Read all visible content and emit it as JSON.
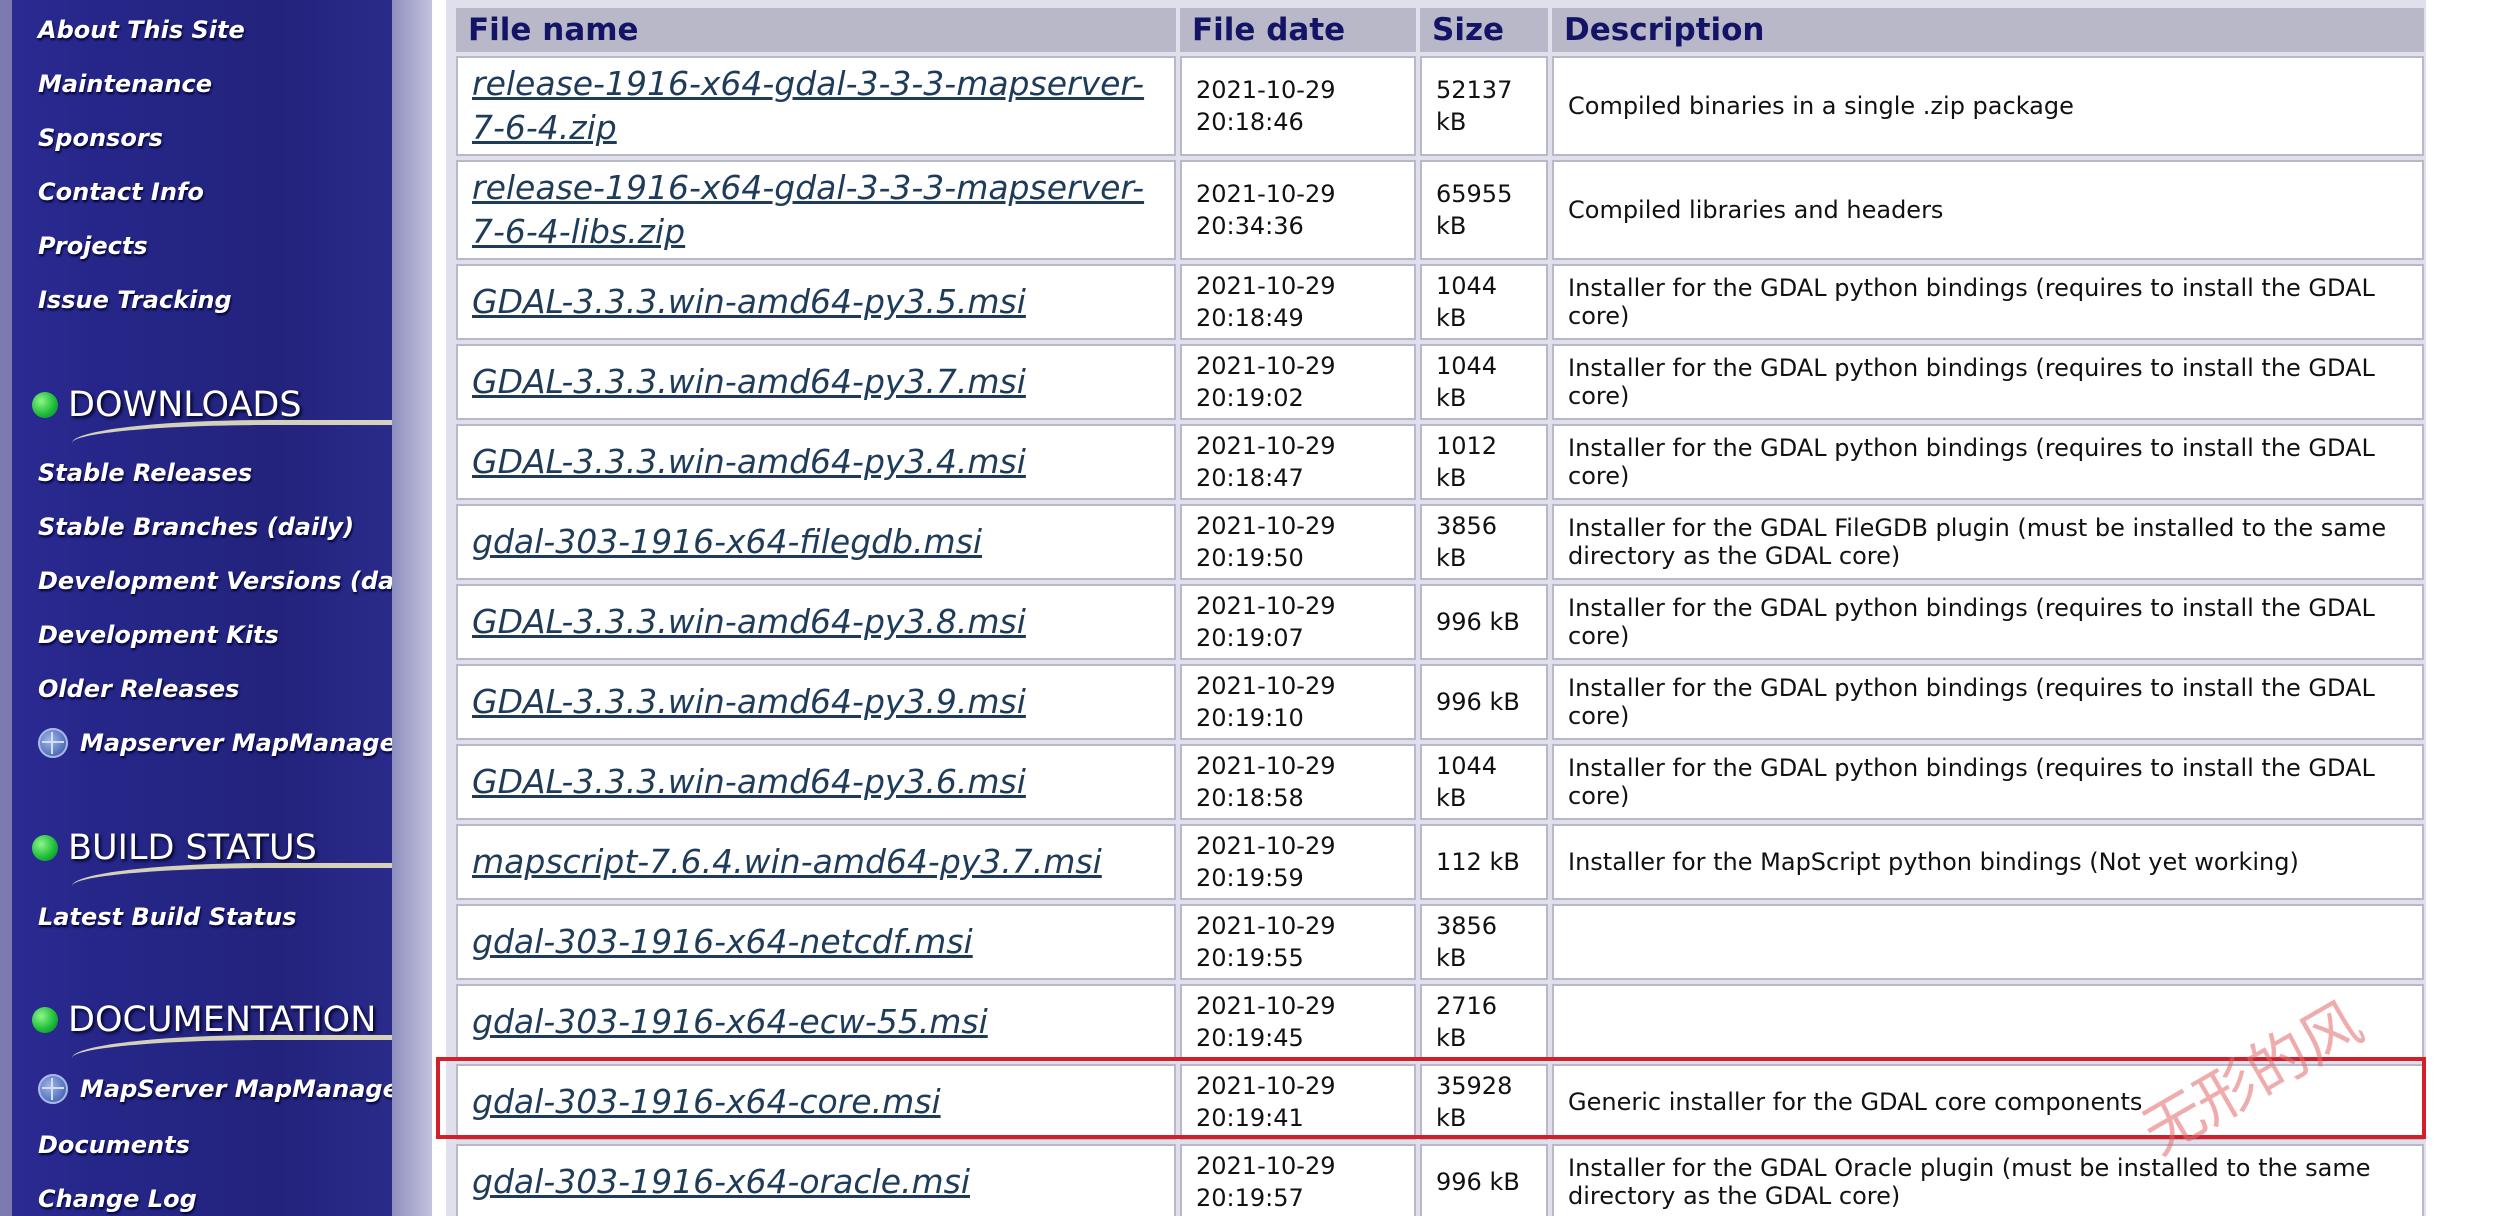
{
  "sidebar": {
    "links_top": [
      "About This Site",
      "Maintenance",
      "Sponsors",
      "Contact Info",
      "Projects",
      "Issue Tracking"
    ],
    "downloads": {
      "title": "DOWNLOADS",
      "items": [
        "Stable Releases",
        "Stable Branches (daily)",
        "Development Versions (daily)",
        "Development Kits",
        "Older Releases",
        "Mapserver MapManager"
      ]
    },
    "build_status": {
      "title": "BUILD STATUS",
      "items": [
        "Latest Build Status"
      ]
    },
    "documentation": {
      "title": "DOCUMENTATION",
      "items": [
        "MapServer MapManager",
        "Documents",
        "Change Log"
      ]
    },
    "icons": {
      "section": "green-globe-icon",
      "mapmanager": "globe-icon"
    }
  },
  "table": {
    "headers": {
      "file_name": "File name",
      "file_date": "File date",
      "size": "Size",
      "description": "Description"
    },
    "rows": [
      {
        "name_line1": "release-1916-x64-gdal-3-3-3-mapserver-",
        "name_line2": "7-6-4.zip",
        "date": "2021-10-29",
        "time": "20:18:46",
        "size": "52137",
        "size_unit": "kB",
        "description": "Compiled binaries in a single .zip package",
        "description2": ""
      },
      {
        "name_line1": "release-1916-x64-gdal-3-3-3-mapserver-",
        "name_line2": "7-6-4-libs.zip",
        "date": "2021-10-29",
        "time": "20:34:36",
        "size": "65955",
        "size_unit": "kB",
        "description": "Compiled libraries and headers",
        "description2": ""
      },
      {
        "name_line1": "GDAL-3.3.3.win-amd64-py3.5.msi",
        "name_line2": "",
        "date": "2021-10-29",
        "time": "20:18:49",
        "size": "1044 kB",
        "size_unit": "",
        "description": "Installer for the GDAL python bindings (requires to install the GDAL core)",
        "description2": ""
      },
      {
        "name_line1": "GDAL-3.3.3.win-amd64-py3.7.msi",
        "name_line2": "",
        "date": "2021-10-29",
        "time": "20:19:02",
        "size": "1044 kB",
        "size_unit": "",
        "description": "Installer for the GDAL python bindings (requires to install the GDAL core)",
        "description2": ""
      },
      {
        "name_line1": "GDAL-3.3.3.win-amd64-py3.4.msi",
        "name_line2": "",
        "date": "2021-10-29",
        "time": "20:18:47",
        "size": "1012 kB",
        "size_unit": "",
        "description": "Installer for the GDAL python bindings (requires to install the GDAL core)",
        "description2": ""
      },
      {
        "name_line1": "gdal-303-1916-x64-filegdb.msi",
        "name_line2": "",
        "date": "2021-10-29",
        "time": "20:19:50",
        "size": "3856 kB",
        "size_unit": "",
        "description": "Installer for the GDAL FileGDB plugin (must be installed to the same",
        "description2": "directory as the GDAL core)"
      },
      {
        "name_line1": "GDAL-3.3.3.win-amd64-py3.8.msi",
        "name_line2": "",
        "date": "2021-10-29",
        "time": "20:19:07",
        "size": "996 kB",
        "size_unit": "",
        "description": "Installer for the GDAL python bindings (requires to install the GDAL core)",
        "description2": ""
      },
      {
        "name_line1": "GDAL-3.3.3.win-amd64-py3.9.msi",
        "name_line2": "",
        "date": "2021-10-29",
        "time": "20:19:10",
        "size": "996 kB",
        "size_unit": "",
        "description": "Installer for the GDAL python bindings (requires to install the GDAL core)",
        "description2": ""
      },
      {
        "name_line1": "GDAL-3.3.3.win-amd64-py3.6.msi",
        "name_line2": "",
        "date": "2021-10-29",
        "time": "20:18:58",
        "size": "1044 kB",
        "size_unit": "",
        "description": "Installer for the GDAL python bindings (requires to install the GDAL core)",
        "description2": ""
      },
      {
        "name_line1": "mapscript-7.6.4.win-amd64-py3.7.msi",
        "name_line2": "",
        "date": "2021-10-29",
        "time": "20:19:59",
        "size": "112 kB",
        "size_unit": "",
        "description": "Installer for the MapScript python bindings (Not yet working)",
        "description2": ""
      },
      {
        "name_line1": "gdal-303-1916-x64-netcdf.msi",
        "name_line2": "",
        "date": "2021-10-29",
        "time": "20:19:55",
        "size": "3856 kB",
        "size_unit": "",
        "description": "",
        "description2": ""
      },
      {
        "name_line1": "gdal-303-1916-x64-ecw-55.msi",
        "name_line2": "",
        "date": "2021-10-29",
        "time": "20:19:45",
        "size": "2716 kB",
        "size_unit": "",
        "description": "",
        "description2": ""
      },
      {
        "name_line1": "gdal-303-1916-x64-core.msi",
        "name_line2": "",
        "date": "2021-10-29",
        "time": "20:19:41",
        "size": "35928",
        "size_unit": "kB",
        "description": "Generic installer for the GDAL core components",
        "description2": ""
      },
      {
        "name_line1": "gdal-303-1916-x64-oracle.msi",
        "name_line2": "",
        "date": "2021-10-29",
        "time": "20:19:57",
        "size": "996 kB",
        "size_unit": "",
        "description": "Installer for the GDAL Oracle plugin (must be installed to the same",
        "description2": "directory as the GDAL core)"
      }
    ]
  },
  "watermark": "无形的风",
  "colors": {
    "sidebar_bg": "#262689",
    "header_bg": "#b8b8c8",
    "header_text": "#141466",
    "link": "#1e3c5a",
    "highlight": "#d21f2a"
  }
}
